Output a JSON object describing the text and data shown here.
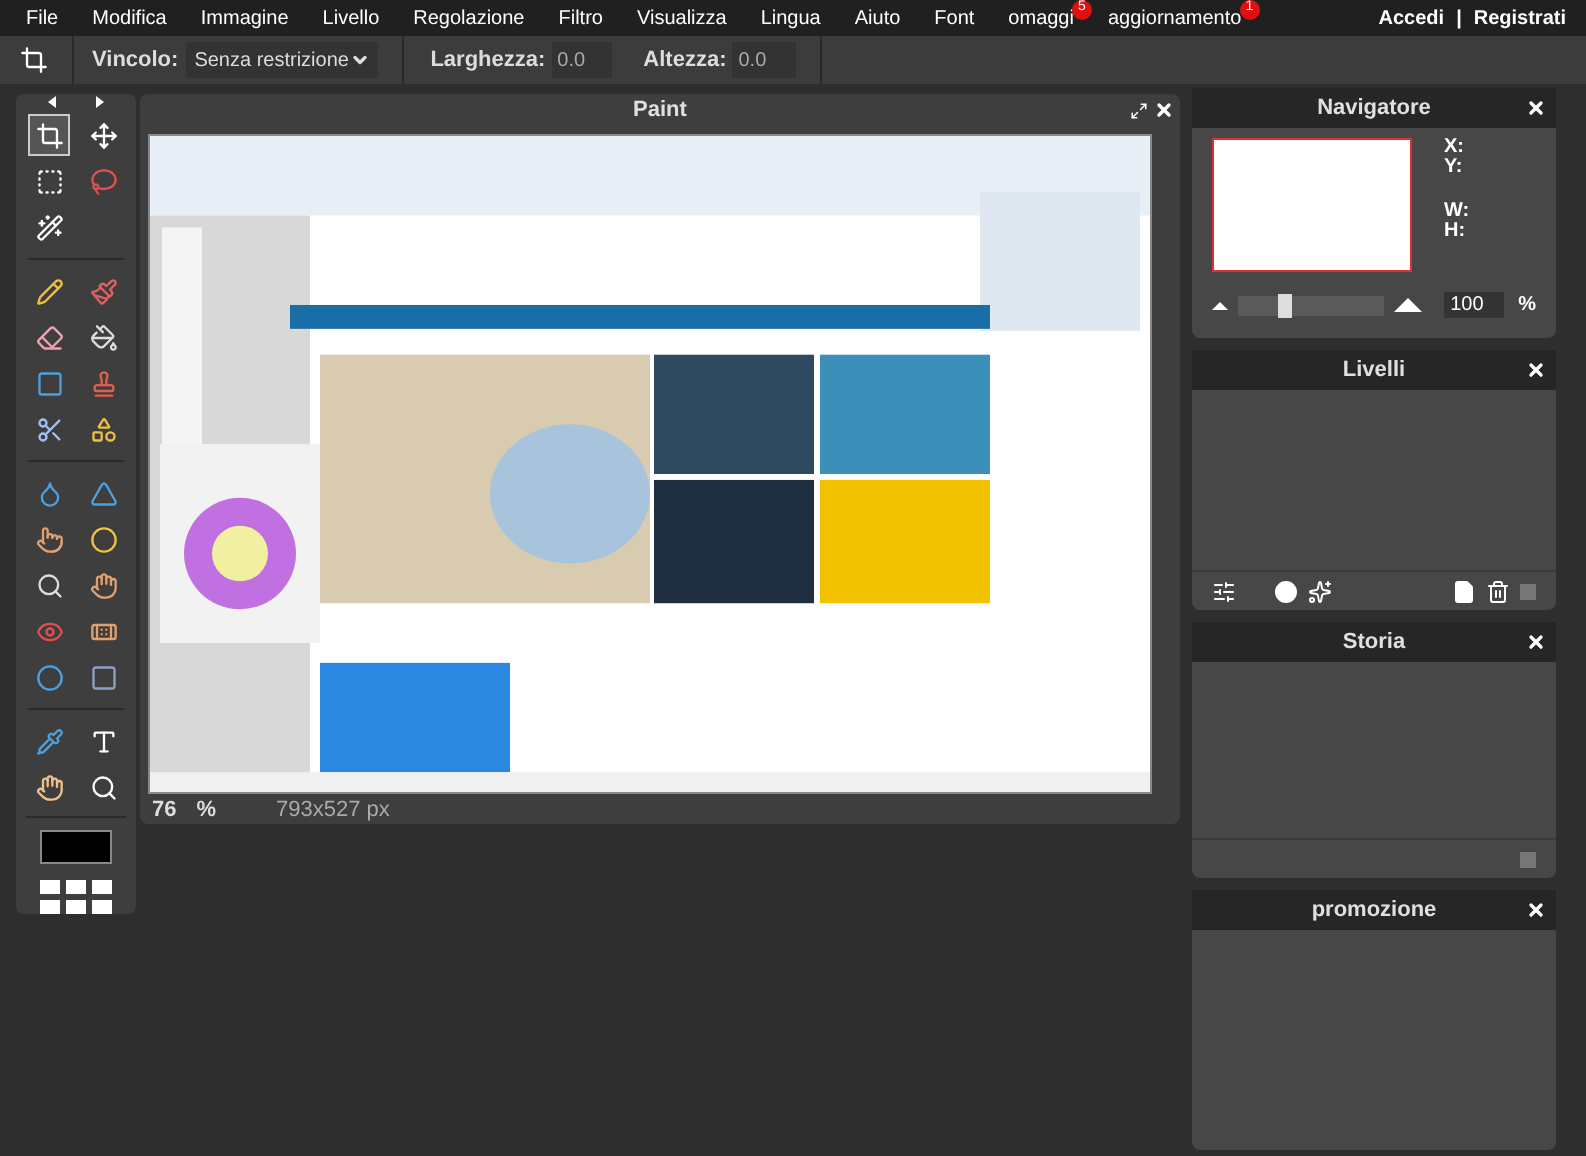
{
  "menu": [
    {
      "label": "File"
    },
    {
      "label": "Modifica"
    },
    {
      "label": "Immagine"
    },
    {
      "label": "Livello"
    },
    {
      "label": "Regolazione"
    },
    {
      "label": "Filtro"
    },
    {
      "label": "Visualizza"
    },
    {
      "label": "Lingua"
    },
    {
      "label": "Aiuto"
    },
    {
      "label": "Font"
    },
    {
      "label": "omaggi",
      "badge": "5"
    },
    {
      "label": "aggiornamento",
      "badge": "1"
    }
  ],
  "account": {
    "login": "Accedi",
    "separator": "|",
    "register": "Registrati"
  },
  "options": {
    "constraint_label": "Vincolo:",
    "constraint_value": "Senza restrizione",
    "width_label": "Larghezza:",
    "width_value": "0.0",
    "height_label": "Altezza:",
    "height_value": "0.0"
  },
  "tools": [
    {
      "selected": true
    },
    {
      "selected": false
    },
    {
      "selected": false
    },
    {
      "selected": false
    },
    {
      "selected": false
    },
    {
      "selected": false
    },
    {
      "selected": false
    },
    {
      "selected": false
    },
    {
      "selected": false
    },
    {
      "selected": false
    },
    {
      "selected": false
    },
    {
      "selected": false
    },
    {
      "selected": false
    },
    {
      "selected": false
    },
    {
      "selected": false
    },
    {
      "selected": false
    },
    {
      "selected": false
    },
    {
      "selected": false
    },
    {
      "selected": false
    },
    {
      "selected": false
    },
    {
      "selected": false
    },
    {
      "selected": false
    },
    {
      "selected": false
    },
    {
      "selected": false
    },
    {
      "selected": false
    },
    {
      "selected": false
    },
    {
      "selected": false
    }
  ],
  "document": {
    "title": "Paint",
    "zoom": "76",
    "zoom_unit": "%",
    "size": "793x527 px"
  },
  "navigator": {
    "title": "Navigatore",
    "x_label": "X:",
    "y_label": "Y:",
    "w_label": "W:",
    "h_label": "H:",
    "level": 0.28,
    "zoom": "100",
    "zoom_unit": "%"
  },
  "panels": [
    {
      "title": "Livelli"
    },
    {
      "title": "Storia"
    },
    {
      "title": "promozione"
    }
  ]
}
